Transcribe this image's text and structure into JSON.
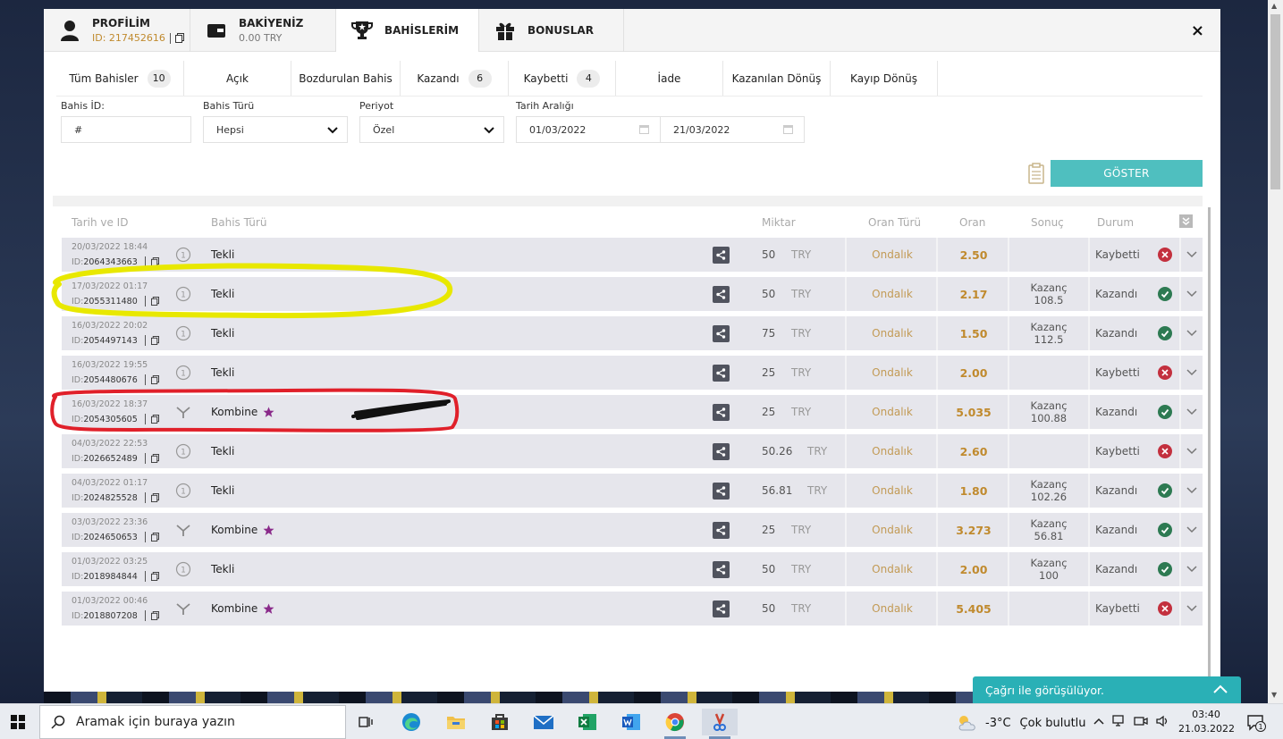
{
  "top_tabs": [
    {
      "title": "PROFİLİM",
      "sub": "ID: 217452616"
    },
    {
      "title": "BAKİYENİZ",
      "sub": "0.00 TRY"
    },
    {
      "title": "BAHİSLERİM"
    },
    {
      "title": "BONUSLAR"
    }
  ],
  "close_label": "×",
  "filter_tabs": [
    {
      "label": "Tüm Bahisler",
      "count": "10"
    },
    {
      "label": "Açık"
    },
    {
      "label": "Bozdurulan Bahis"
    },
    {
      "label": "Kazandı",
      "count": "6"
    },
    {
      "label": "Kaybetti",
      "count": "4"
    },
    {
      "label": "İade"
    },
    {
      "label": "Kazanılan Dönüş"
    },
    {
      "label": "Kayıp Dönüş"
    }
  ],
  "filters": {
    "bet_id_label": "Bahis İD:",
    "bet_id_placeholder": "#",
    "bet_type_label": "Bahis Türü",
    "bet_type_value": "Hepsi",
    "period_label": "Periyot",
    "period_value": "Özel",
    "date_range_label": "Tarih Aralığı",
    "date_from": "01/03/2022",
    "date_to": "21/03/2022",
    "show_button": "GÖSTER"
  },
  "table": {
    "headers": {
      "date_id": "Tarih ve ID",
      "bet_type": "Bahis Türü",
      "amount": "Miktar",
      "odds_type": "Oran Türü",
      "odds": "Oran",
      "result": "Sonuç",
      "status": "Durum"
    },
    "rows": [
      {
        "date": "20/03/2022 18:44",
        "id": "2064343663",
        "type": "Tekli",
        "kind": "single",
        "amount": "50",
        "currency": "TRY",
        "odds_type": "Ondalık",
        "odds": "2.50",
        "result_label": "",
        "result_value": "",
        "status": "Kaybetti",
        "won": false
      },
      {
        "date": "17/03/2022 01:17",
        "id": "2055311480",
        "type": "Tekli",
        "kind": "single",
        "amount": "50",
        "currency": "TRY",
        "odds_type": "Ondalık",
        "odds": "2.17",
        "result_label": "Kazanç",
        "result_value": "108.5",
        "status": "Kazandı",
        "won": true
      },
      {
        "date": "16/03/2022 20:02",
        "id": "2054497143",
        "type": "Tekli",
        "kind": "single",
        "amount": "75",
        "currency": "TRY",
        "odds_type": "Ondalık",
        "odds": "1.50",
        "result_label": "Kazanç",
        "result_value": "112.5",
        "status": "Kazandı",
        "won": true
      },
      {
        "date": "16/03/2022 19:55",
        "id": "2054480676",
        "type": "Tekli",
        "kind": "single",
        "amount": "25",
        "currency": "TRY",
        "odds_type": "Ondalık",
        "odds": "2.00",
        "result_label": "",
        "result_value": "",
        "status": "Kaybetti",
        "won": false
      },
      {
        "date": "16/03/2022 18:37",
        "id": "2054305605",
        "type": "Kombine",
        "kind": "combo",
        "amount": "25",
        "currency": "TRY",
        "odds_type": "Ondalık",
        "odds": "5.035",
        "result_label": "Kazanç",
        "result_value": "100.88",
        "status": "Kazandı",
        "won": true
      },
      {
        "date": "04/03/2022 22:53",
        "id": "2026652489",
        "type": "Tekli",
        "kind": "single",
        "amount": "50.26",
        "currency": "TRY",
        "odds_type": "Ondalık",
        "odds": "2.60",
        "result_label": "",
        "result_value": "",
        "status": "Kaybetti",
        "won": false
      },
      {
        "date": "04/03/2022 01:17",
        "id": "2024825528",
        "type": "Tekli",
        "kind": "single",
        "amount": "56.81",
        "currency": "TRY",
        "odds_type": "Ondalık",
        "odds": "1.80",
        "result_label": "Kazanç",
        "result_value": "102.26",
        "status": "Kazandı",
        "won": true
      },
      {
        "date": "03/03/2022 23:36",
        "id": "2024650653",
        "type": "Kombine",
        "kind": "combo",
        "amount": "25",
        "currency": "TRY",
        "odds_type": "Ondalık",
        "odds": "3.273",
        "result_label": "Kazanç",
        "result_value": "56.81",
        "status": "Kazandı",
        "won": true
      },
      {
        "date": "01/03/2022 03:25",
        "id": "2018984844",
        "type": "Tekli",
        "kind": "single",
        "amount": "50",
        "currency": "TRY",
        "odds_type": "Ondalık",
        "odds": "2.00",
        "result_label": "Kazanç",
        "result_value": "100",
        "status": "Kazandı",
        "won": true
      },
      {
        "date": "01/03/2022 00:46",
        "id": "2018807208",
        "type": "Kombine",
        "kind": "combo",
        "amount": "50",
        "currency": "TRY",
        "odds_type": "Ondalık",
        "odds": "5.405",
        "result_label": "",
        "result_value": "",
        "status": "Kaybetti",
        "won": false
      }
    ],
    "id_prefix": "ID:"
  },
  "chat": {
    "label": "Çağrı ile görüşülüyor."
  },
  "taskbar": {
    "search_placeholder": "Aramak için buraya yazın",
    "temperature": "-3°C",
    "weather": "Çok bulutlu",
    "time": "03:40",
    "date": "21.03.2022",
    "notifications": "1"
  },
  "colors": {
    "accent_teal": "#4fbfbf",
    "odds_gold": "#c08a2e",
    "lost_red": "#c3303e",
    "won_green": "#2d7a52",
    "row_bg": "#e6e6ec",
    "annotation_yellow": "#e8e800",
    "annotation_red": "#e0202a"
  }
}
